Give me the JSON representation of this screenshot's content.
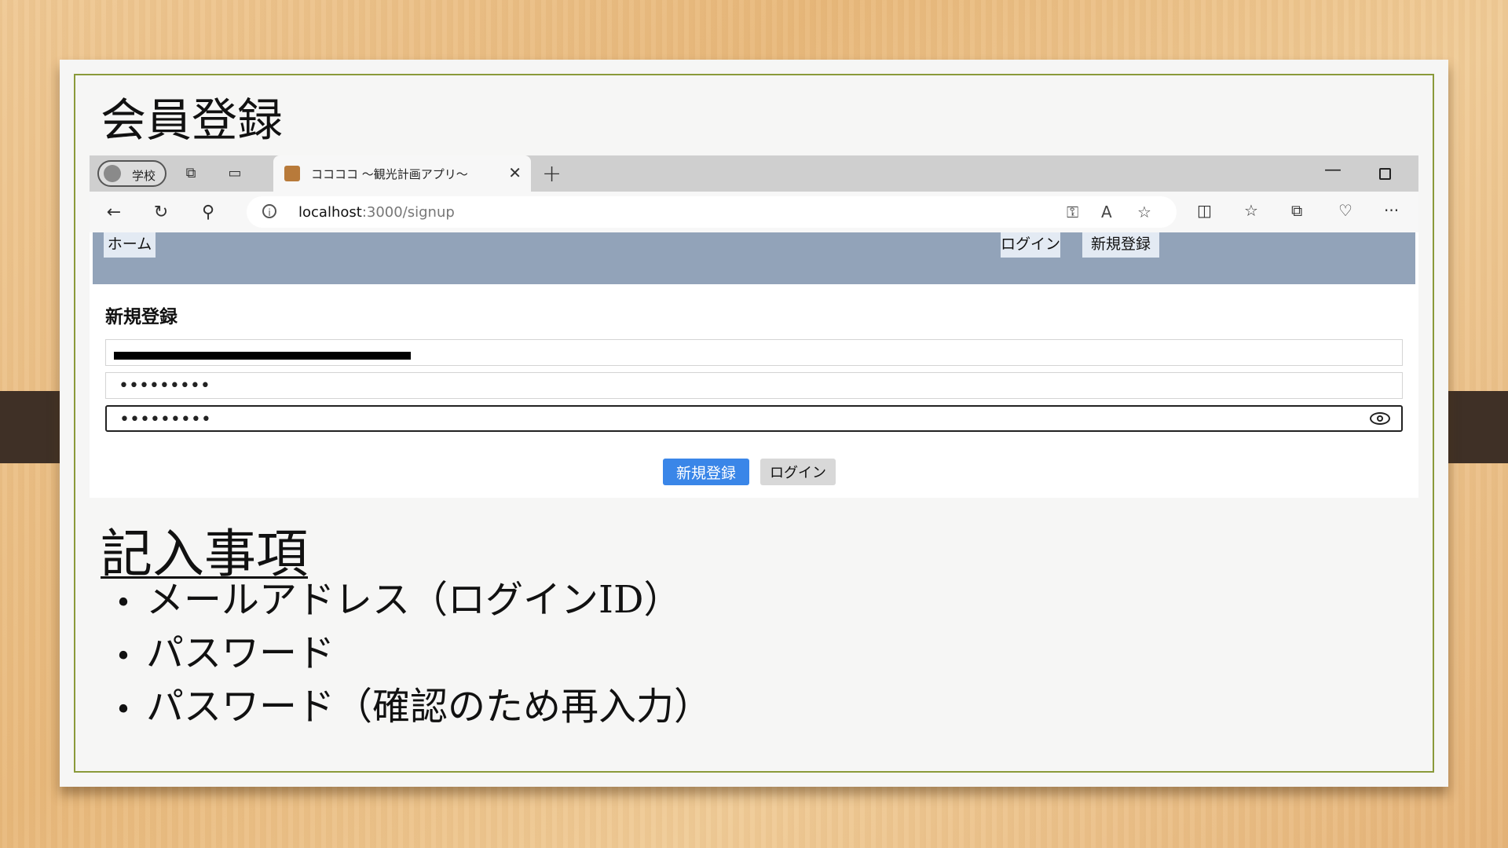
{
  "slide": {
    "title": "会員登録",
    "section_heading": "記入事項",
    "bullets": [
      "メールアドレス（ログインID）",
      "パスワード",
      "パスワード（確認のため再入力）"
    ]
  },
  "browser": {
    "profile_label": "学校",
    "tab_title": "ココココ 〜観光計画アプリ〜",
    "new_tab_symbol": "+",
    "url_host": "localhost",
    "url_path": ":3000/signup"
  },
  "site": {
    "nav": {
      "home": "ホーム",
      "login": "ログイン",
      "signup": "新規登録"
    },
    "form": {
      "title": "新規登録",
      "email_value": "",
      "password_value": "•••••••••",
      "password_confirm_value": "•••••••••",
      "submit_label": "新規登録",
      "login_label": "ログイン"
    }
  },
  "colors": {
    "accent_blue": "#3a86e8",
    "header_bg": "#92a3b9",
    "slide_border": "#8a9a3a"
  }
}
